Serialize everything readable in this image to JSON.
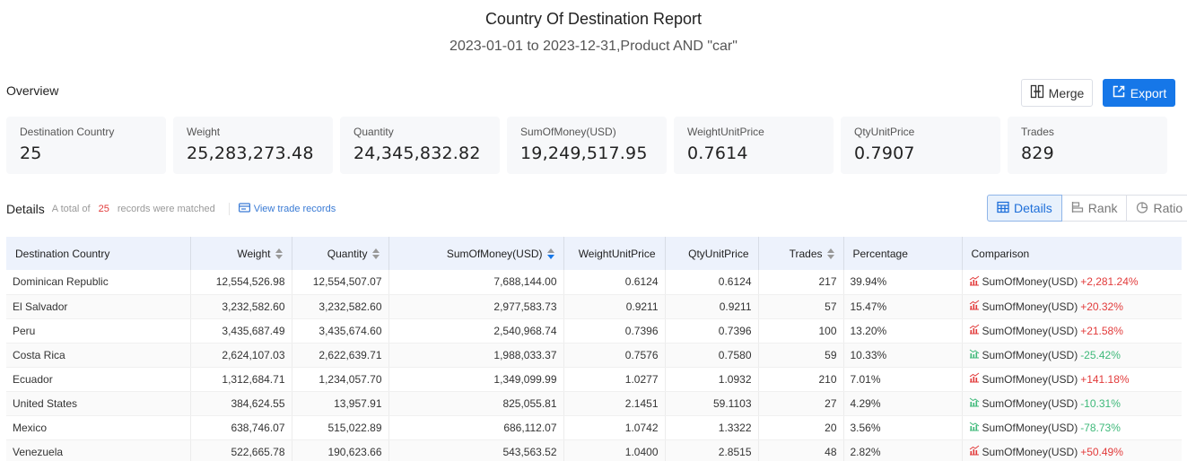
{
  "header": {
    "title": "Country Of Destination Report",
    "subtitle": "2023-01-01 to 2023-12-31,Product AND \"car\""
  },
  "overview": {
    "label": "Overview",
    "merge_label": "Merge",
    "export_label": "Export",
    "cards": [
      {
        "label": "Destination Country",
        "value": "25"
      },
      {
        "label": "Weight",
        "value": "25,283,273.48"
      },
      {
        "label": "Quantity",
        "value": "24,345,832.82"
      },
      {
        "label": "SumOfMoney(USD)",
        "value": "19,249,517.95"
      },
      {
        "label": "WeightUnitPrice",
        "value": "0.7614"
      },
      {
        "label": "QtyUnitPrice",
        "value": "0.7907"
      },
      {
        "label": "Trades",
        "value": "829"
      }
    ]
  },
  "details": {
    "title": "Details",
    "note_prefix": "A total of",
    "count": "25",
    "note_suffix": "records were matched",
    "view_link": "View trade records",
    "tabs": [
      {
        "label": "Details",
        "icon": "table-icon",
        "active": true
      },
      {
        "label": "Rank",
        "icon": "bar-rank-icon",
        "active": false
      },
      {
        "label": "Ratio",
        "icon": "pie-icon",
        "active": false
      }
    ]
  },
  "table": {
    "columns": [
      {
        "label": "Destination Country",
        "sortable": false
      },
      {
        "label": "Weight",
        "sortable": true
      },
      {
        "label": "Quantity",
        "sortable": true
      },
      {
        "label": "SumOfMoney(USD)",
        "sortable": true,
        "sorted": "desc"
      },
      {
        "label": "WeightUnitPrice",
        "sortable": false
      },
      {
        "label": "QtyUnitPrice",
        "sortable": false
      },
      {
        "label": "Trades",
        "sortable": true
      },
      {
        "label": "Percentage",
        "sortable": false
      },
      {
        "label": "Comparison",
        "sortable": false
      }
    ],
    "rows": [
      {
        "country": "Dominican Republic",
        "weight": "12,554,526.98",
        "quantity": "12,554,507.07",
        "money": "7,688,144.00",
        "wup": "0.6124",
        "qup": "0.6124",
        "trades": "217",
        "pct": "39.94%",
        "cmp_label": "SumOfMoney(USD)",
        "cmp_value": "+2,281.24%",
        "trend": "up"
      },
      {
        "country": "El Salvador",
        "weight": "3,232,582.60",
        "quantity": "3,232,582.60",
        "money": "2,977,583.73",
        "wup": "0.9211",
        "qup": "0.9211",
        "trades": "57",
        "pct": "15.47%",
        "cmp_label": "SumOfMoney(USD)",
        "cmp_value": "+20.32%",
        "trend": "up"
      },
      {
        "country": "Peru",
        "weight": "3,435,687.49",
        "quantity": "3,435,674.60",
        "money": "2,540,968.74",
        "wup": "0.7396",
        "qup": "0.7396",
        "trades": "100",
        "pct": "13.20%",
        "cmp_label": "SumOfMoney(USD)",
        "cmp_value": "+21.58%",
        "trend": "up"
      },
      {
        "country": "Costa Rica",
        "weight": "2,624,107.03",
        "quantity": "2,622,639.71",
        "money": "1,988,033.37",
        "wup": "0.7576",
        "qup": "0.7580",
        "trades": "59",
        "pct": "10.33%",
        "cmp_label": "SumOfMoney(USD)",
        "cmp_value": "-25.42%",
        "trend": "down"
      },
      {
        "country": "Ecuador",
        "weight": "1,312,684.71",
        "quantity": "1,234,057.70",
        "money": "1,349,099.99",
        "wup": "1.0277",
        "qup": "1.0932",
        "trades": "210",
        "pct": "7.01%",
        "cmp_label": "SumOfMoney(USD)",
        "cmp_value": "+141.18%",
        "trend": "up"
      },
      {
        "country": "United States",
        "weight": "384,624.55",
        "quantity": "13,957.91",
        "money": "825,055.81",
        "wup": "2.1451",
        "qup": "59.1103",
        "trades": "27",
        "pct": "4.29%",
        "cmp_label": "SumOfMoney(USD)",
        "cmp_value": "-10.31%",
        "trend": "down"
      },
      {
        "country": "Mexico",
        "weight": "638,746.07",
        "quantity": "515,022.89",
        "money": "686,112.07",
        "wup": "1.0742",
        "qup": "1.3322",
        "trades": "20",
        "pct": "3.56%",
        "cmp_label": "SumOfMoney(USD)",
        "cmp_value": "-78.73%",
        "trend": "down"
      },
      {
        "country": "Venezuela",
        "weight": "522,665.78",
        "quantity": "190,623.66",
        "money": "543,563.52",
        "wup": "1.0400",
        "qup": "2.8515",
        "trades": "48",
        "pct": "2.82%",
        "cmp_label": "SumOfMoney(USD)",
        "cmp_value": "+50.49%",
        "trend": "up"
      }
    ]
  },
  "colors": {
    "accent": "#1677e8",
    "up": "#e23b3b",
    "down": "#3fb97a",
    "header_bg": "#edf2fc"
  }
}
